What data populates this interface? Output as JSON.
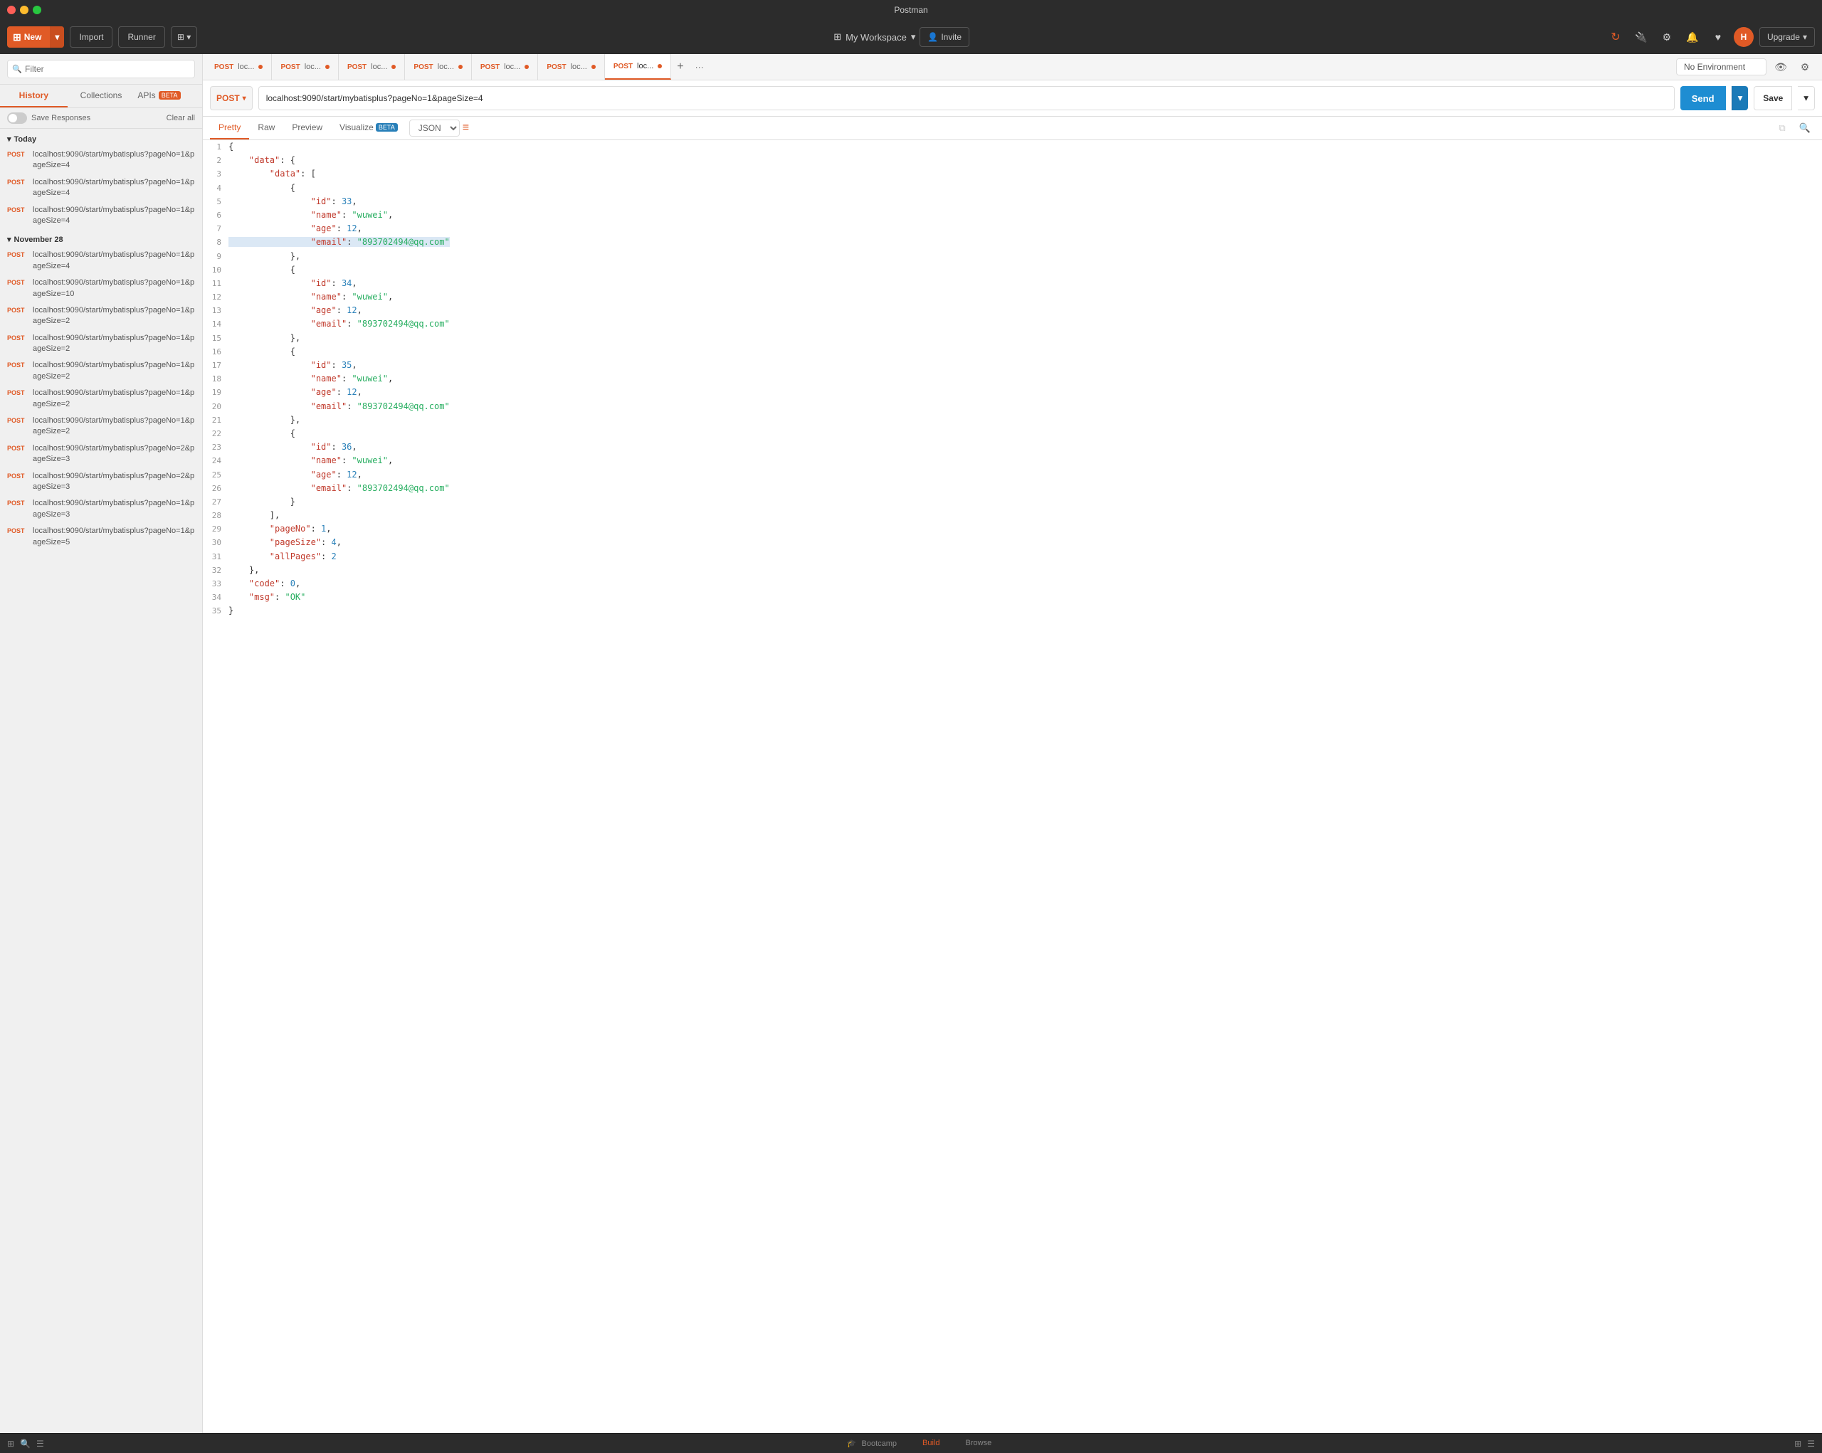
{
  "titleBar": {
    "title": "Postman"
  },
  "toolbar": {
    "newLabel": "New",
    "importLabel": "Import",
    "runnerLabel": "Runner",
    "workspaceLabel": "My Workspace",
    "inviteLabel": "Invite",
    "upgradeLabel": "Upgrade",
    "avatarLetter": "H"
  },
  "sidebar": {
    "filterPlaceholder": "Filter",
    "tabs": [
      "History",
      "Collections",
      "APIs"
    ],
    "apisBeta": "BETA",
    "saveResponses": "Save Responses",
    "clearAll": "Clear all",
    "groups": [
      {
        "label": "Today",
        "items": [
          {
            "method": "POST",
            "url": "localhost:9090/start/mybatisplus?pageNo=1&pageSize=4"
          },
          {
            "method": "POST",
            "url": "localhost:9090/start/mybatisplus?pageNo=1&pageSize=4"
          },
          {
            "method": "POST",
            "url": "localhost:9090/start/mybatisplus?pageNo=1&pageSize=4"
          }
        ]
      },
      {
        "label": "November 28",
        "items": [
          {
            "method": "POST",
            "url": "localhost:9090/start/mybatisplus?pageNo=1&pageSize=4"
          },
          {
            "method": "POST",
            "url": "localhost:9090/start/mybatisplus?pageNo=1&pageSize=10"
          },
          {
            "method": "POST",
            "url": "localhost:9090/start/mybatisplus?pageNo=1&pageSize=2"
          },
          {
            "method": "POST",
            "url": "localhost:9090/start/mybatisplus?pageNo=1&pageSize=2"
          },
          {
            "method": "POST",
            "url": "localhost:9090/start/mybatisplus?pageNo=1&pageSize=2"
          },
          {
            "method": "POST",
            "url": "localhost:9090/start/mybatisplus?pageNo=1&pageSize=2"
          },
          {
            "method": "POST",
            "url": "localhost:9090/start/mybatisplus?pageNo=1&pageSize=2"
          },
          {
            "method": "POST",
            "url": "localhost:9090/start/mybatisplus?pageNo=2&pageSize=3"
          },
          {
            "method": "POST",
            "url": "localhost:9090/start/mybatisplus?pageNo=2&pageSize=3"
          },
          {
            "method": "POST",
            "url": "localhost:9090/start/mybatisplus?pageNo=1&pageSize=3"
          },
          {
            "method": "POST",
            "url": "localhost:9090/start/mybatisplus?pageNo=1&pageSize=5"
          }
        ]
      }
    ]
  },
  "requestTabs": [
    {
      "method": "POST",
      "url": "loc...",
      "active": false,
      "dot": true
    },
    {
      "method": "POST",
      "url": "loc...",
      "active": false,
      "dot": true
    },
    {
      "method": "POST",
      "url": "loc...",
      "active": false,
      "dot": true
    },
    {
      "method": "POST",
      "url": "loc...",
      "active": false,
      "dot": true
    },
    {
      "method": "POST",
      "url": "loc...",
      "active": false,
      "dot": true
    },
    {
      "method": "POST",
      "url": "loc...",
      "active": false,
      "dot": true
    },
    {
      "method": "POST",
      "url": "loc...",
      "active": true,
      "dot": true
    }
  ],
  "requestBar": {
    "method": "POST",
    "url": "localhost:9090/start/mybatisplus?pageNo=1&pageSize=4",
    "sendLabel": "Send",
    "saveLabel": "Save"
  },
  "environment": {
    "selected": "No Environment"
  },
  "responseTabs": [
    "Pretty",
    "Raw",
    "Preview",
    "Visualize"
  ],
  "responseFormat": "JSON",
  "responseData": {
    "lines": [
      {
        "num": 1,
        "content": "{"
      },
      {
        "num": 2,
        "content": "    \"data\": {"
      },
      {
        "num": 3,
        "content": "        \"data\": ["
      },
      {
        "num": 4,
        "content": "            {"
      },
      {
        "num": 5,
        "content": "                \"id\": 33,"
      },
      {
        "num": 6,
        "content": "                \"name\": \"wuwei\","
      },
      {
        "num": 7,
        "content": "                \"age\": 12,"
      },
      {
        "num": 8,
        "content": "                \"email\": \"893702494@qq.com\""
      },
      {
        "num": 9,
        "content": "            },"
      },
      {
        "num": 10,
        "content": "            {"
      },
      {
        "num": 11,
        "content": "                \"id\": 34,"
      },
      {
        "num": 12,
        "content": "                \"name\": \"wuwei\","
      },
      {
        "num": 13,
        "content": "                \"age\": 12,"
      },
      {
        "num": 14,
        "content": "                \"email\": \"893702494@qq.com\""
      },
      {
        "num": 15,
        "content": "            },"
      },
      {
        "num": 16,
        "content": "            {"
      },
      {
        "num": 17,
        "content": "                \"id\": 35,"
      },
      {
        "num": 18,
        "content": "                \"name\": \"wuwei\","
      },
      {
        "num": 19,
        "content": "                \"age\": 12,"
      },
      {
        "num": 20,
        "content": "                \"email\": \"893702494@qq.com\""
      },
      {
        "num": 21,
        "content": "            },"
      },
      {
        "num": 22,
        "content": "            {"
      },
      {
        "num": 23,
        "content": "                \"id\": 36,"
      },
      {
        "num": 24,
        "content": "                \"name\": \"wuwei\","
      },
      {
        "num": 25,
        "content": "                \"age\": 12,"
      },
      {
        "num": 26,
        "content": "                \"email\": \"893702494@qq.com\""
      },
      {
        "num": 27,
        "content": "            }"
      },
      {
        "num": 28,
        "content": "        ],"
      },
      {
        "num": 29,
        "content": "        \"pageNo\": 1,"
      },
      {
        "num": 30,
        "content": "        \"pageSize\": 4,"
      },
      {
        "num": 31,
        "content": "        \"allPages\": 2"
      },
      {
        "num": 32,
        "content": "    },"
      },
      {
        "num": 33,
        "content": "    \"code\": 0,"
      },
      {
        "num": 34,
        "content": "    \"msg\": \"OK\""
      },
      {
        "num": 35,
        "content": "}"
      }
    ]
  },
  "statusBar": {
    "bootcamp": "Bootcamp",
    "build": "Build",
    "browse": "Browse"
  }
}
